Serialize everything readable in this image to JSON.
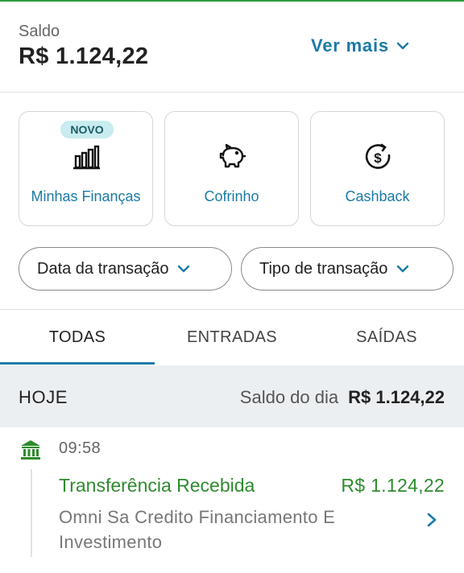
{
  "balance": {
    "label": "Saldo",
    "value": "R$ 1.124,22",
    "ver_mais": "Ver mais"
  },
  "cards": [
    {
      "label": "Minhas Finanças",
      "badge": "NOVO",
      "icon": "bar-chart-icon"
    },
    {
      "label": "Cofrinho",
      "icon": "piggy-bank-icon"
    },
    {
      "label": "Cashback",
      "icon": "cashback-dollar-icon"
    }
  ],
  "filters": {
    "date": "Data da transação",
    "type": "Tipo de transação"
  },
  "tabs": [
    {
      "label": "TODAS",
      "active": true
    },
    {
      "label": "ENTRADAS",
      "active": false
    },
    {
      "label": "SAÍDAS",
      "active": false
    }
  ],
  "day": {
    "label": "HOJE",
    "balance_label": "Saldo do dia",
    "balance_value": "R$ 1.124,22"
  },
  "transaction": {
    "time": "09:58",
    "title": "Transferência Recebida",
    "amount": "R$ 1.124,22",
    "description": "Omni Sa Credito  Financiamento E Investimento",
    "icon": "bank-icon"
  },
  "colors": {
    "accent": "#1a7aa6",
    "positive": "#2e8b2e",
    "top_line": "#2e9a3c",
    "badge_bg": "#c8ecef"
  }
}
